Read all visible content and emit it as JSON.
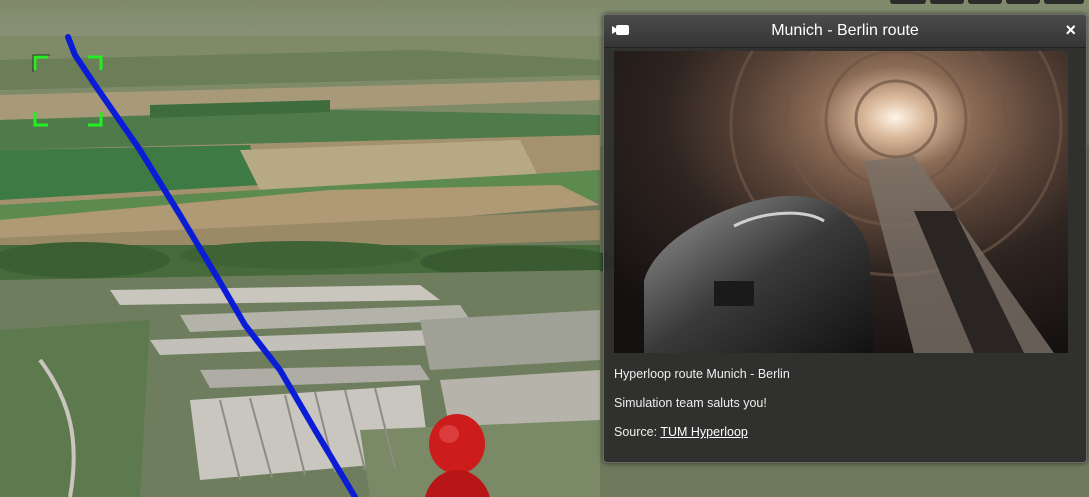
{
  "popup": {
    "title": "Munich - Berlin route",
    "close_label": "×",
    "description_line1": "Hyperloop route Munich - Berlin",
    "description_line2": "Simulation team saluts you!",
    "source_label": "Source:",
    "source_link_text": "TUM Hyperloop",
    "image": "hyperloop-pod-in-tube"
  },
  "map": {
    "route_color": "#0a1cd6",
    "frame_icon_color": "#22ee22",
    "marker_color": "#cc1c1c",
    "icons": [
      "camera-icon",
      "close-icon",
      "selection-frame-icon",
      "person-marker-icon"
    ]
  },
  "colors": {
    "popup_bg": "#2a2a2a",
    "header_bg": "#3e3e3e",
    "text": "#eaeaea"
  }
}
